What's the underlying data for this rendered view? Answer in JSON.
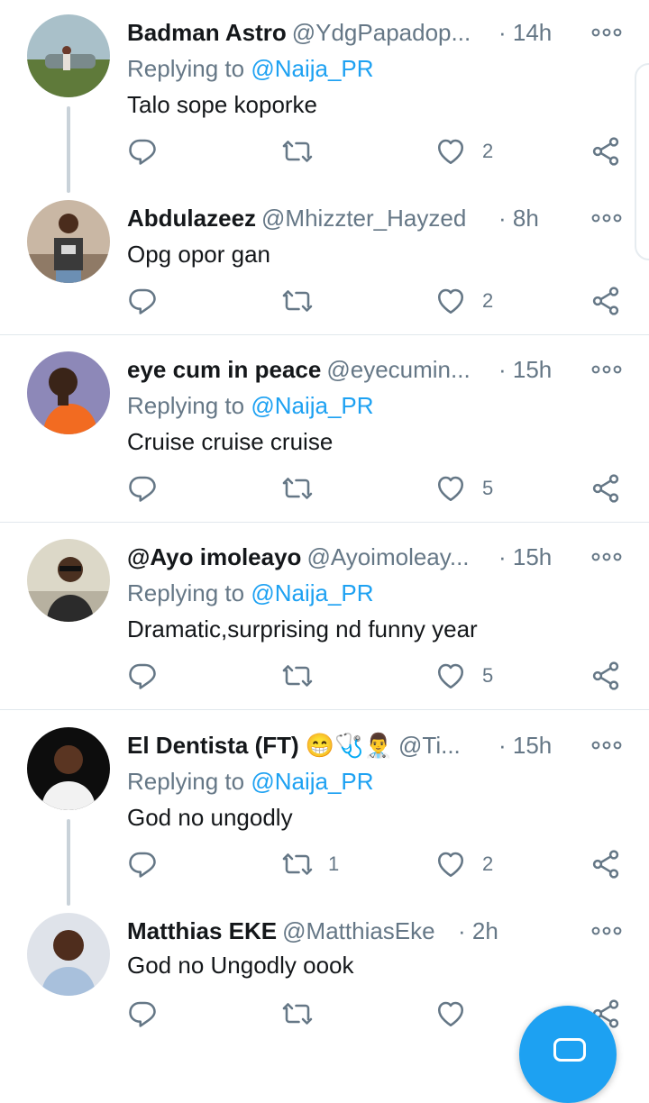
{
  "tweets": [
    {
      "name": "Badman Astro",
      "handle": "@YdgPapadop...",
      "time": "· 14h",
      "replying_prefix": "Replying to ",
      "replying_to": "@Naija_PR",
      "text": "Talo sope koporke",
      "retweets": "",
      "likes": "2",
      "avatar": "avatar-car-outdoor"
    },
    {
      "name": "Abdulazeez",
      "handle": "@Mhizzter_Hayzed",
      "time": "· 8h",
      "replying_prefix": "",
      "replying_to": "",
      "text": "Opg opor gan",
      "retweets": "",
      "likes": "2",
      "avatar": "avatar-man-pose"
    },
    {
      "name": "eye cum in peace",
      "handle": "@eyecumin...",
      "time": "· 15h",
      "replying_prefix": "Replying to ",
      "replying_to": "@Naija_PR",
      "text": "Cruise cruise cruise",
      "retweets": "",
      "likes": "5",
      "avatar": "avatar-orange-shirt"
    },
    {
      "name": "@Ayo imoleayo",
      "handle": "@Ayoimoleay...",
      "time": "· 15h",
      "replying_prefix": "Replying to ",
      "replying_to": "@Naija_PR",
      "text": "Dramatic,surprising nd funny year",
      "retweets": "",
      "likes": "5",
      "avatar": "avatar-sunglasses"
    },
    {
      "name": "El Dentista (FT) 😁🩺👨‍⚕️",
      "handle": "@Ti...",
      "time": "· 15h",
      "replying_prefix": "Replying to ",
      "replying_to": "@Naija_PR",
      "text": "God no ungodly",
      "retweets": "1",
      "likes": "2",
      "avatar": "avatar-white-shirt"
    },
    {
      "name": "Matthias EKE",
      "handle": "@MatthiasEke",
      "time": "· 2h",
      "replying_prefix": "",
      "replying_to": "",
      "text": "God no Ungodly oook",
      "retweets": "",
      "likes": "",
      "avatar": "avatar-smiling-man"
    }
  ],
  "icons": {
    "reply": "reply-icon",
    "retweet": "retweet-icon",
    "like": "heart-icon",
    "share": "share-icon",
    "more": "more-icon",
    "compose": "compose-icon"
  },
  "colors": {
    "accent": "#1da1f2",
    "secondary_text": "#657786",
    "primary_text": "#14171a",
    "divider": "#e1e8ed"
  }
}
